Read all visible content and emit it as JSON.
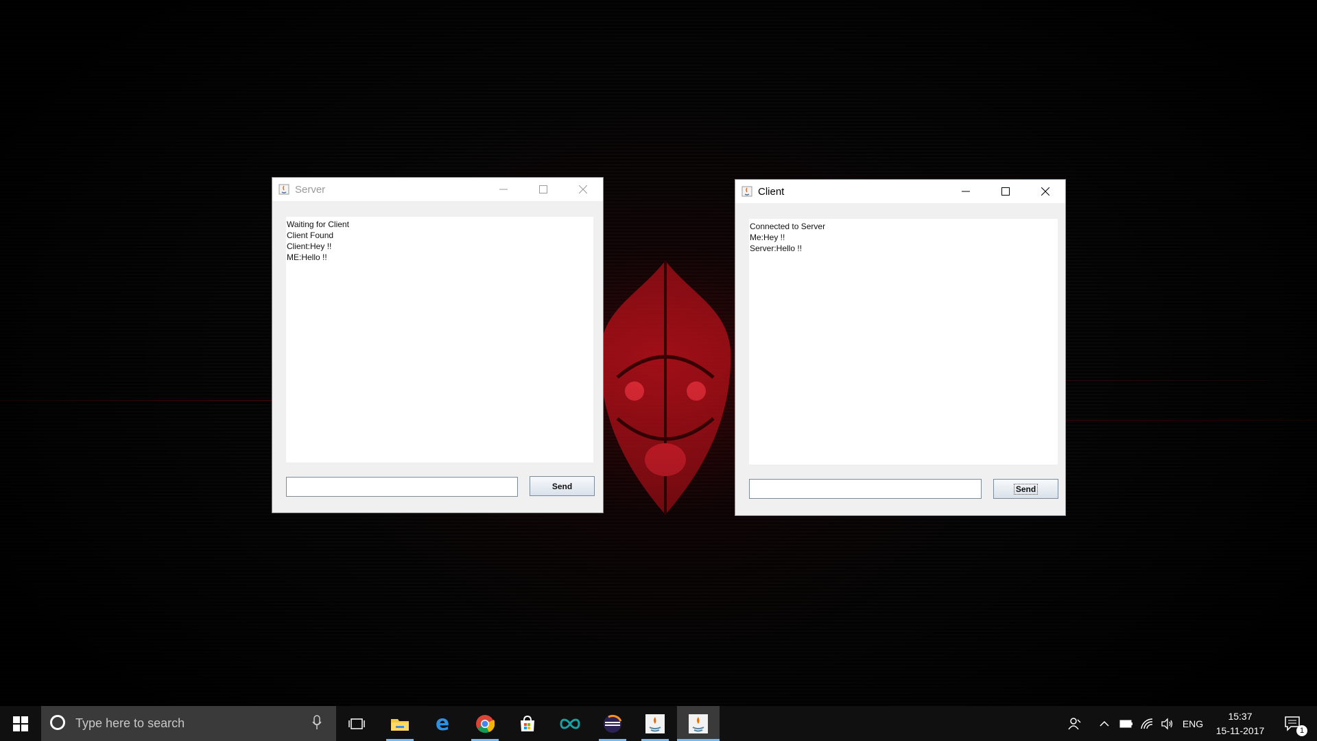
{
  "server_window": {
    "title": "Server",
    "messages": [
      "Waiting for Client",
      "Client Found",
      "Client:Hey !!",
      "ME:Hello !!"
    ],
    "input_value": "",
    "send_label": "Send"
  },
  "client_window": {
    "title": "Client",
    "messages": [
      "Connected to Server",
      "Me:Hey !!",
      "Server:Hello !!"
    ],
    "input_value": "",
    "send_label": "Send"
  },
  "taskbar": {
    "search_placeholder": "Type here to search",
    "apps": [
      "start-icon",
      "task-view-icon",
      "file-explorer-icon",
      "edge-icon",
      "chrome-icon",
      "store-icon",
      "arduino-icon",
      "eclipse-icon",
      "java-icon",
      "java-icon"
    ],
    "language": "ENG",
    "time": "15:37",
    "date": "15-11-2017",
    "notification_count": "1"
  },
  "colors": {
    "taskbar_accent": "#76b9ed",
    "desktop_red": "#c8141e"
  }
}
